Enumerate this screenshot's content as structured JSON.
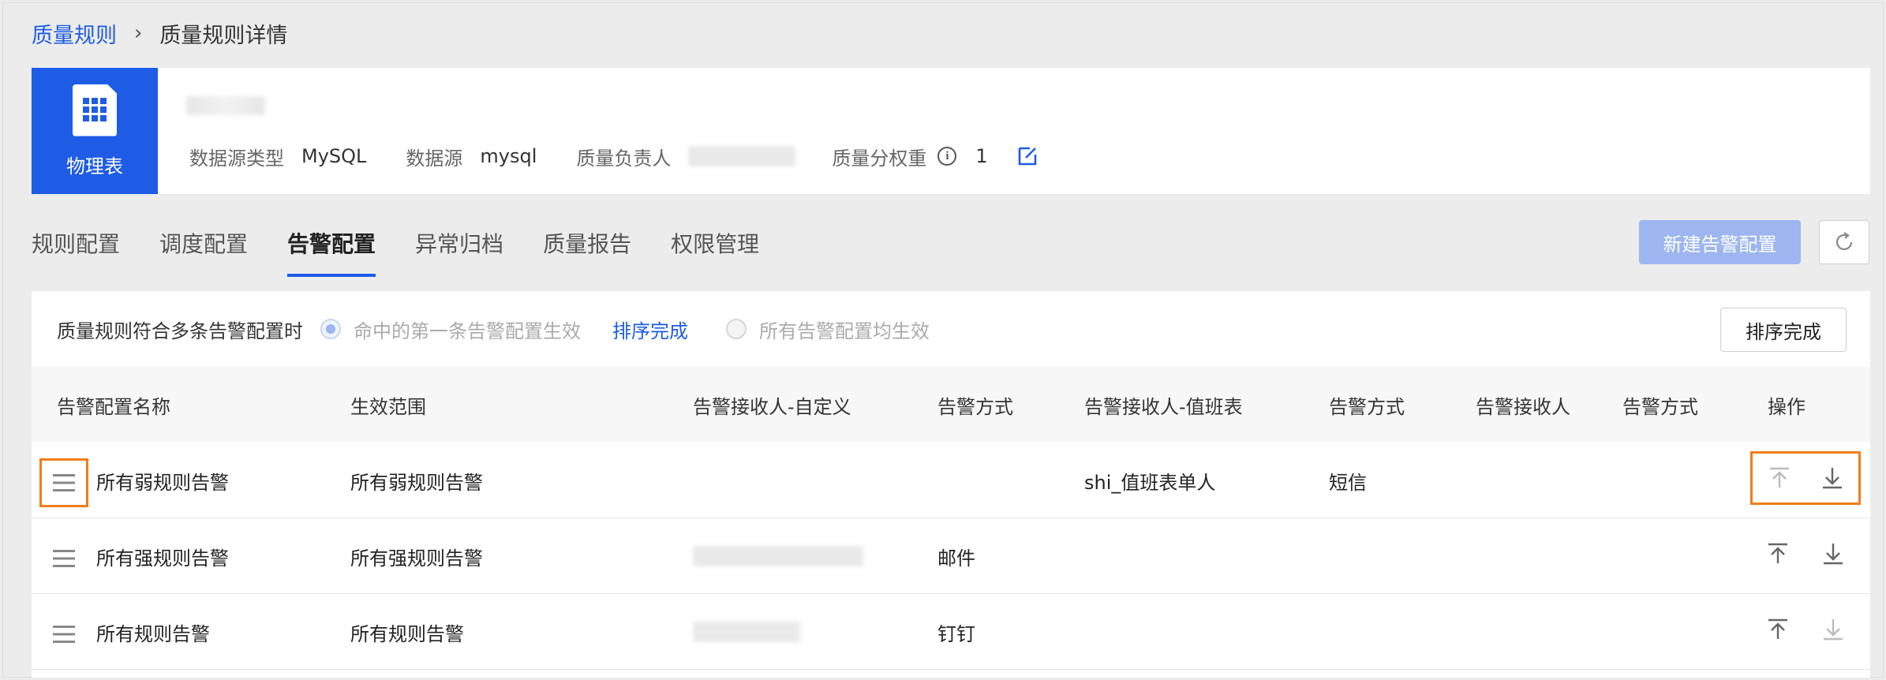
{
  "breadcrumb": {
    "parent": "质量规则",
    "separator": "›",
    "current": "质量规则详情"
  },
  "header": {
    "type_label": "物理表",
    "meta": {
      "source_type_label": "数据源类型",
      "source_type_value": "MySQL",
      "source_label": "数据源",
      "source_value": "mysql",
      "owner_label": "质量负责人",
      "weight_label": "质量分权重",
      "weight_value": "1"
    }
  },
  "tabs": [
    {
      "label": "规则配置"
    },
    {
      "label": "调度配置"
    },
    {
      "label": "告警配置",
      "active": true
    },
    {
      "label": "异常归档"
    },
    {
      "label": "质量报告"
    },
    {
      "label": "权限管理"
    }
  ],
  "toolbar": {
    "new_button": "新建告警配置"
  },
  "options": {
    "label": "质量规则符合多条告警配置时",
    "radio1": "命中的第一条告警配置生效",
    "sort_link": "排序完成",
    "radio2": "所有告警配置均生效",
    "sort_done_button": "排序完成"
  },
  "table": {
    "columns": [
      "告警配置名称",
      "生效范围",
      "告警接收人-自定义",
      "告警方式",
      "告警接收人-值班表",
      "告警方式",
      "告警接收人",
      "告警方式",
      "操作"
    ],
    "rows": [
      {
        "name": "所有弱规则告警",
        "scope": "所有弱规则告警",
        "custom_receiver": "",
        "method1": "",
        "duty_receiver": "shi_值班表单人",
        "method2": "短信",
        "receiver": "",
        "method3": ""
      },
      {
        "name": "所有强规则告警",
        "scope": "所有强规则告警",
        "custom_receiver": "",
        "method1": "邮件",
        "duty_receiver": "",
        "method2": "",
        "receiver": "",
        "method3": ""
      },
      {
        "name": "所有规则告警",
        "scope": "所有规则告警",
        "custom_receiver": "",
        "method1": "钉钉",
        "duty_receiver": "",
        "method2": "",
        "receiver": "",
        "method3": ""
      }
    ]
  },
  "colors": {
    "primary": "#1e5ce6",
    "primary_disabled": "#9db6f0",
    "highlight": "#f07d1a"
  }
}
